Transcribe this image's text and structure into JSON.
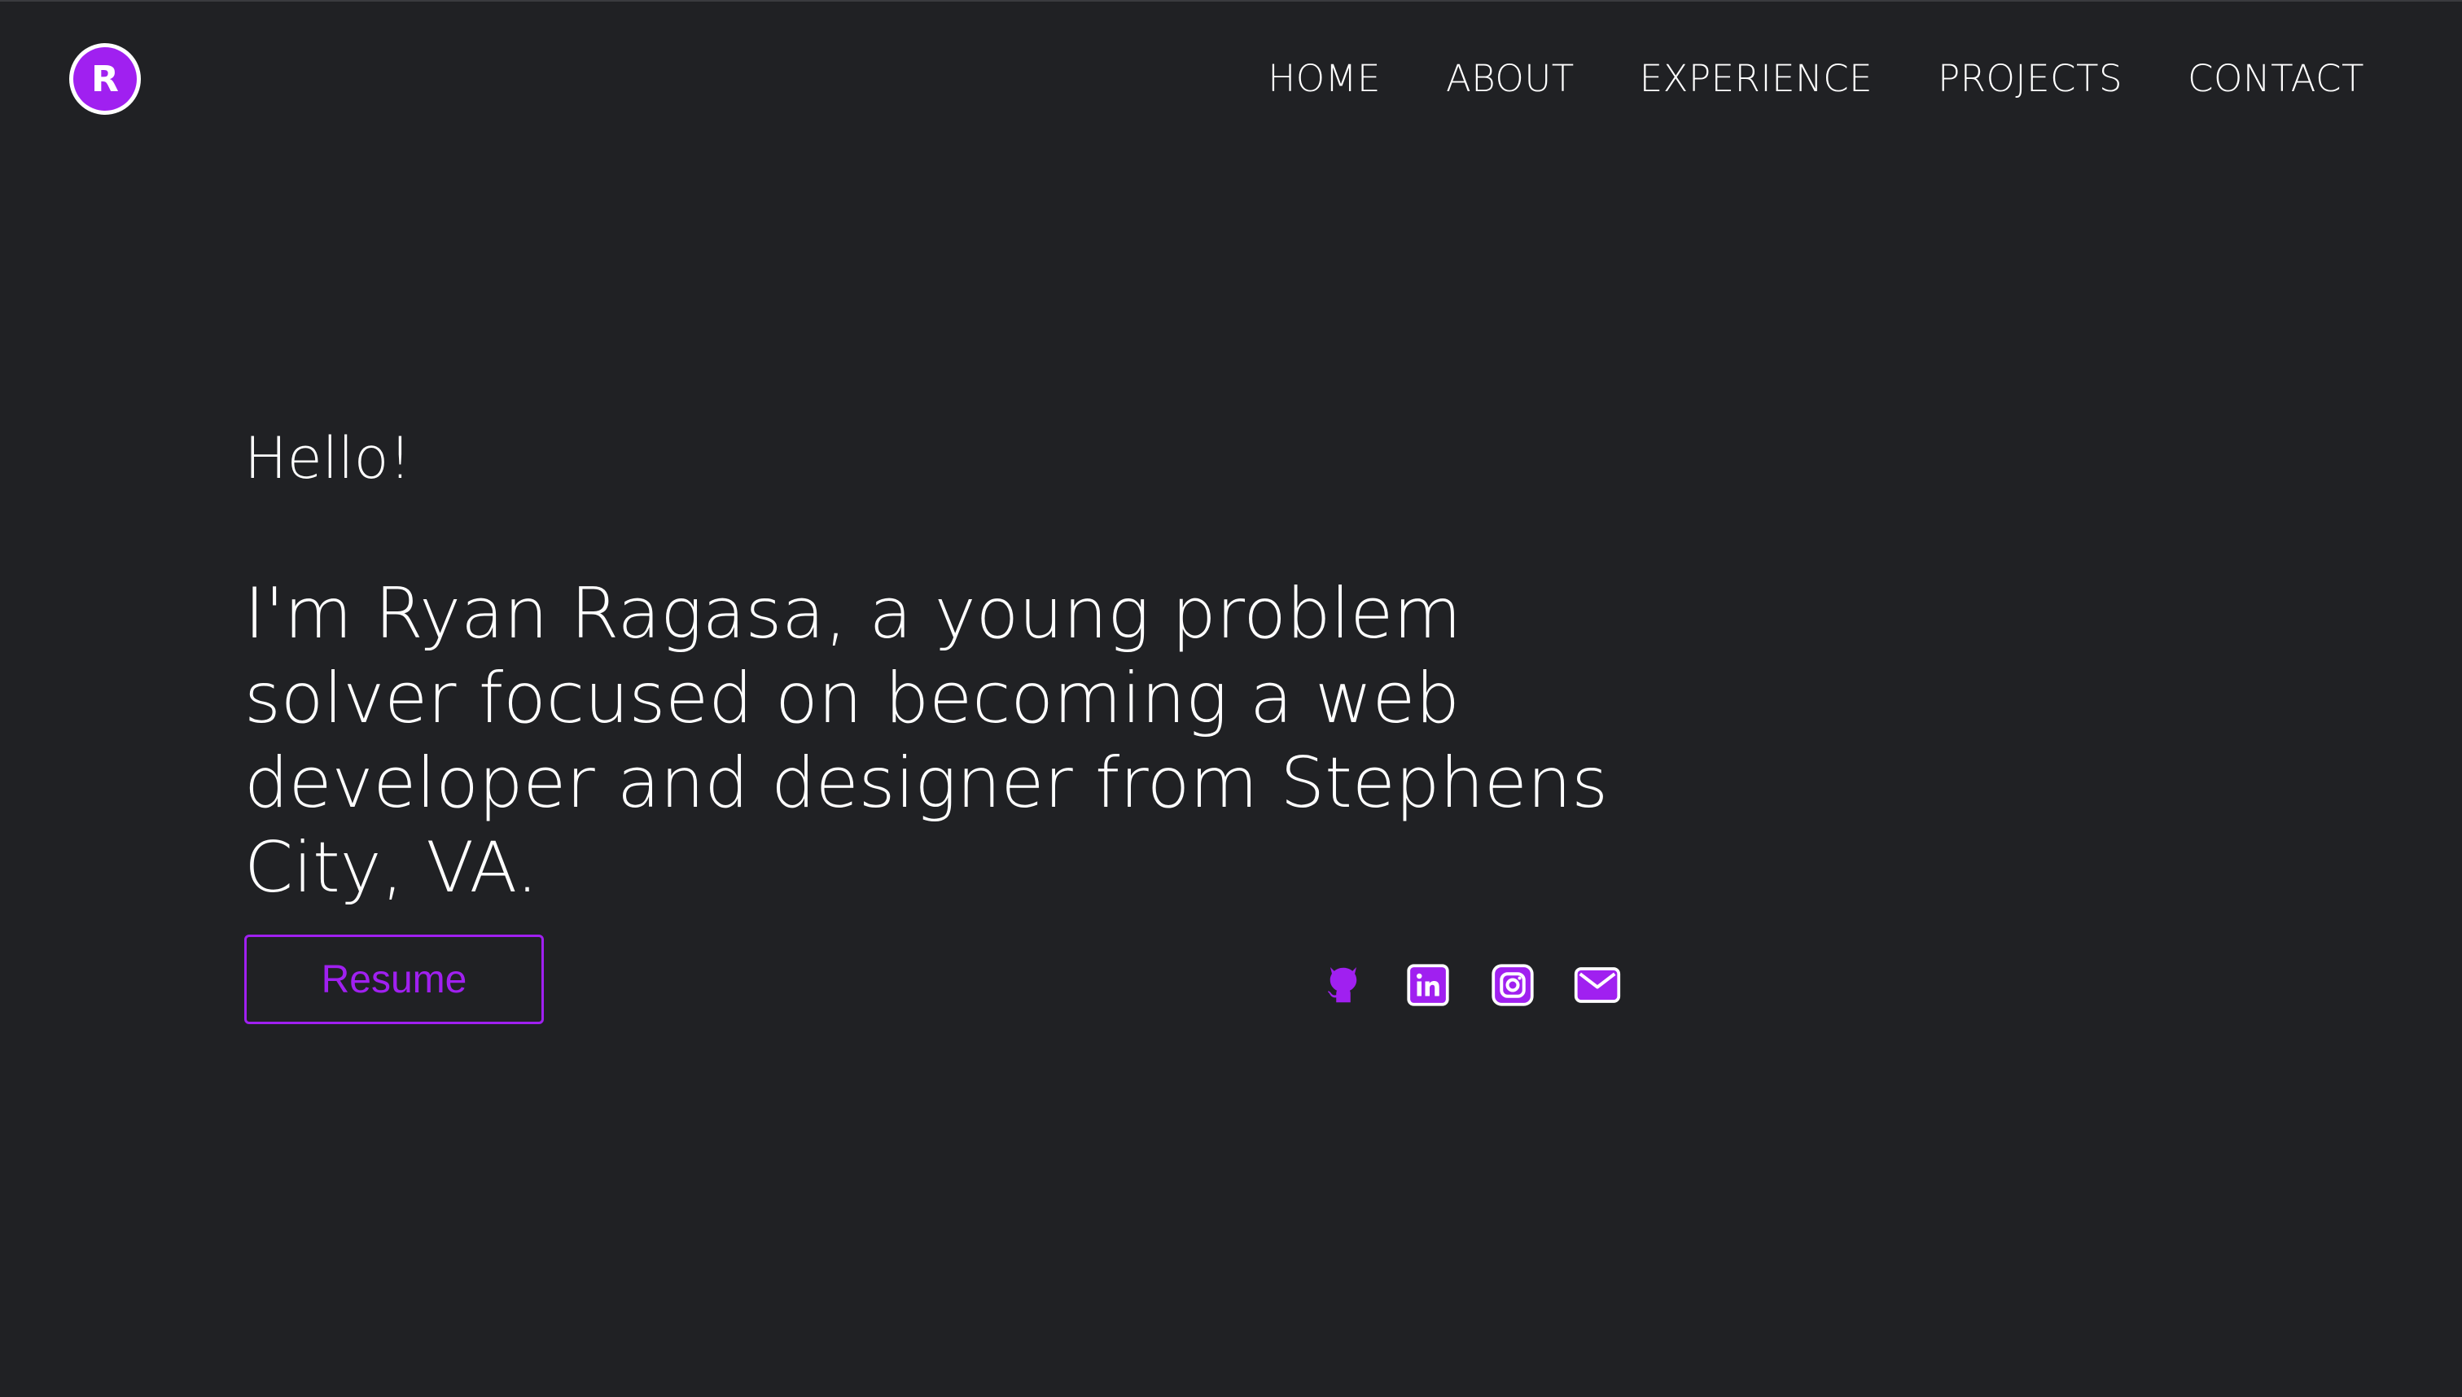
{
  "logo": {
    "letter": "R",
    "accent": "#a020f0",
    "border": "#ffffff"
  },
  "nav": {
    "items": [
      {
        "label": "HOME"
      },
      {
        "label": "ABOUT"
      },
      {
        "label": "EXPERIENCE"
      },
      {
        "label": "PROJECTS"
      },
      {
        "label": "CONTACT"
      }
    ]
  },
  "hero": {
    "greeting": "Hello!",
    "intro": "I'm Ryan Ragasa, a young problem solver focused on becoming a web developer and designer from Stephens City, VA.",
    "resume_label": "Resume"
  },
  "socials": [
    {
      "icon": "github-icon"
    },
    {
      "icon": "linkedin-icon"
    },
    {
      "icon": "instagram-icon"
    },
    {
      "icon": "email-icon"
    }
  ],
  "colors": {
    "background": "#202124",
    "text": "#ffffff",
    "accent": "#a020f0"
  }
}
